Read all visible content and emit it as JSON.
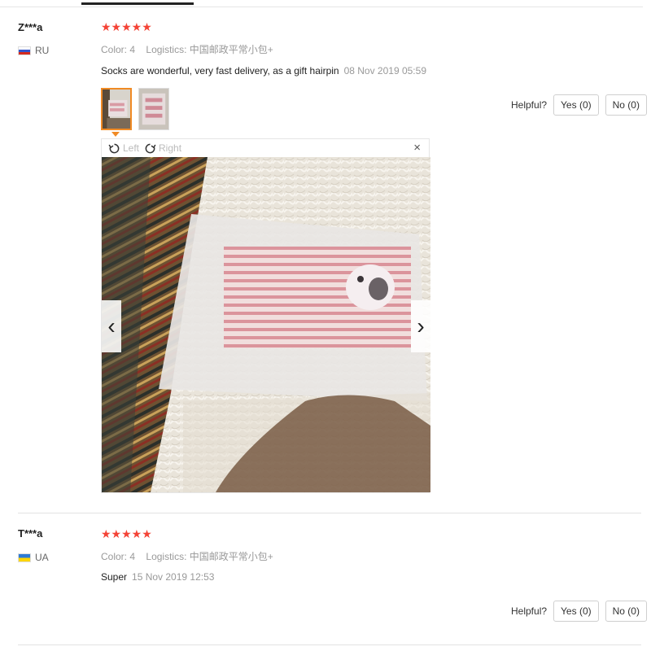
{
  "reviews": [
    {
      "user": "Z***a",
      "country": "RU",
      "stars": "★★★★★",
      "color_label": "Color:",
      "color_value": "4",
      "logistics_label": "Logistics:",
      "logistics_value": "中国邮政平常小包+",
      "text": "Socks are wonderful, very fast delivery, as a gift hairpin",
      "date": "08 Nov 2019 05:59",
      "helpful_label": "Helpful?",
      "yes_label": "Yes (0)",
      "no_label": "No (0)"
    },
    {
      "user": "T***a",
      "country": "UA",
      "stars": "★★★★★",
      "color_label": "Color:",
      "color_value": "4",
      "logistics_label": "Logistics:",
      "logistics_value": "中国邮政平常小包+",
      "text": "Super",
      "date": "15 Nov 2019 12:53",
      "helpful_label": "Helpful?",
      "yes_label": "Yes (0)",
      "no_label": "No (0)"
    }
  ],
  "viewer": {
    "rotate_left_label": "Left",
    "rotate_right_label": "Right",
    "close_glyph": "×",
    "prev_glyph": "‹",
    "next_glyph": "›"
  },
  "colors": {
    "star": "#f44336",
    "active_thumb_border": "#f08a24"
  }
}
